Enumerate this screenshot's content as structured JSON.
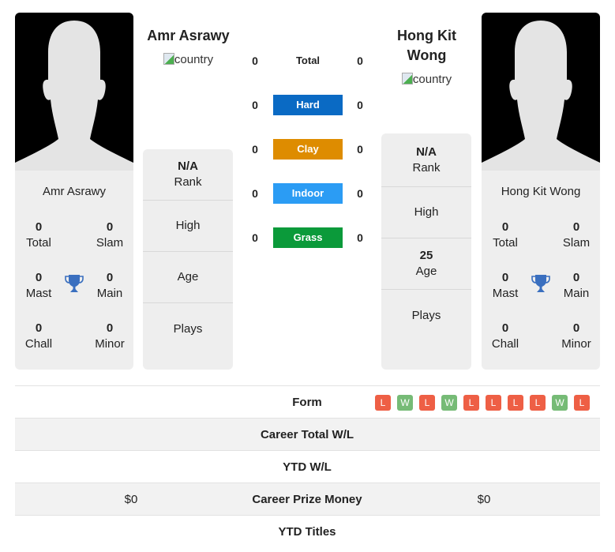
{
  "player1": {
    "name": "Amr Asrawy",
    "country_alt": "country",
    "card_name": "Amr Asrawy",
    "titles": {
      "total": {
        "value": "0",
        "label": "Total"
      },
      "slam": {
        "value": "0",
        "label": "Slam"
      },
      "mast": {
        "value": "0",
        "label": "Mast"
      },
      "main": {
        "value": "0",
        "label": "Main"
      },
      "chall": {
        "value": "0",
        "label": "Chall"
      },
      "minor": {
        "value": "0",
        "label": "Minor"
      }
    },
    "info": {
      "rank": {
        "value": "N/A",
        "label": "Rank"
      },
      "high": {
        "value": "",
        "label": "High"
      },
      "age": {
        "value": "",
        "label": "Age"
      },
      "plays": {
        "value": "",
        "label": "Plays"
      }
    }
  },
  "player2": {
    "name": "Hong Kit Wong",
    "country_alt": "country",
    "card_name": "Hong Kit Wong",
    "titles": {
      "total": {
        "value": "0",
        "label": "Total"
      },
      "slam": {
        "value": "0",
        "label": "Slam"
      },
      "mast": {
        "value": "0",
        "label": "Mast"
      },
      "main": {
        "value": "0",
        "label": "Main"
      },
      "chall": {
        "value": "0",
        "label": "Chall"
      },
      "minor": {
        "value": "0",
        "label": "Minor"
      }
    },
    "info": {
      "rank": {
        "value": "N/A",
        "label": "Rank"
      },
      "high": {
        "value": "",
        "label": "High"
      },
      "age": {
        "value": "25",
        "label": "Age"
      },
      "plays": {
        "value": "",
        "label": "Plays"
      }
    }
  },
  "h2h": [
    {
      "surface": "Total",
      "left": "0",
      "right": "0",
      "color": ""
    },
    {
      "surface": "Hard",
      "left": "0",
      "right": "0",
      "color": "#0a6ac4"
    },
    {
      "surface": "Clay",
      "left": "0",
      "right": "0",
      "color": "#de8c00"
    },
    {
      "surface": "Indoor",
      "left": "0",
      "right": "0",
      "color": "#2b9cf4"
    },
    {
      "surface": "Grass",
      "left": "0",
      "right": "0",
      "color": "#0b9a3a"
    }
  ],
  "table": {
    "form_label": "Form",
    "form": [
      "L",
      "W",
      "L",
      "W",
      "L",
      "L",
      "L",
      "L",
      "W",
      "L"
    ],
    "rows": [
      {
        "label": "Career Total W/L",
        "left": "",
        "right": ""
      },
      {
        "label": "YTD W/L",
        "left": "",
        "right": ""
      },
      {
        "label": "Career Prize Money",
        "left": "$0",
        "right": "$0"
      },
      {
        "label": "YTD Titles",
        "left": "",
        "right": ""
      }
    ]
  },
  "colors": {
    "form_loss": "#ee5f45",
    "form_win": "#76bb76",
    "trophy": "#3a6fbf",
    "panel_bg": "#eeeeee"
  }
}
